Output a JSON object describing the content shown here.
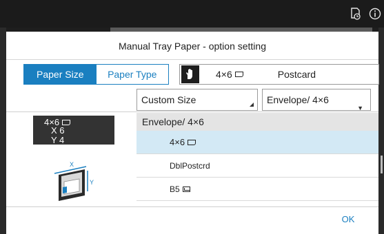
{
  "title": "Manual Tray Paper - option setting",
  "tabs": [
    {
      "label": "Paper Size",
      "active": true
    },
    {
      "label": "Paper Type",
      "active": false
    }
  ],
  "current_paper": {
    "size": "4×6",
    "type": "Postcard"
  },
  "buttons": {
    "custom_size": "Custom Size",
    "envelope_select": "Envelope/ 4×6",
    "ok": "OK"
  },
  "size_panel": {
    "name": "4×6",
    "x": "X 6",
    "y": "Y 4"
  },
  "tray_axis": {
    "x": "X",
    "y": "Y"
  },
  "list": {
    "group": "Envelope/ 4×6",
    "items": [
      {
        "label": "4×6",
        "selected": true
      },
      {
        "label": "DblPostcrd",
        "selected": false
      },
      {
        "label": "B5",
        "selected": false
      }
    ]
  },
  "colors": {
    "accent": "#1a7fc0",
    "selected_row": "#d3e9f5",
    "header_row": "#e4e4e4"
  },
  "icons": {
    "topbar": [
      "job-history-icon",
      "info-icon"
    ],
    "paper": "hand-feed-icon"
  }
}
